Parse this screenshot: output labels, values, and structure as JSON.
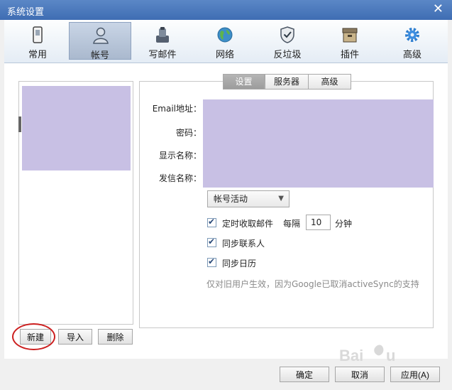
{
  "window": {
    "title": "系统设置"
  },
  "toolbar": {
    "items": [
      {
        "label": "常用",
        "icon": "phone-icon"
      },
      {
        "label": "帐号",
        "icon": "user-icon"
      },
      {
        "label": "写邮件",
        "icon": "compose-icon"
      },
      {
        "label": "网络",
        "icon": "globe-icon"
      },
      {
        "label": "反垃圾",
        "icon": "shield-icon"
      },
      {
        "label": "插件",
        "icon": "box-icon"
      },
      {
        "label": "高级",
        "icon": "gear-icon"
      }
    ],
    "active_index": 1
  },
  "account_panel": {
    "buttons": {
      "new": "新建",
      "import": "导入",
      "delete": "删除"
    }
  },
  "tabs": [
    "设置",
    "服务器",
    "高级"
  ],
  "form": {
    "email_label": "Email地址：",
    "password_label": "密码：",
    "display_name_label": "显示名称：",
    "sender_name_label": "发信名称：",
    "account_activity": "帐号活动",
    "auto_receive": {
      "label": "定时收取邮件",
      "checked": true,
      "every_label": "每隔",
      "interval": "10",
      "unit": "分钟"
    },
    "sync_contacts": {
      "label": "同步联系人",
      "checked": true
    },
    "sync_calendar": {
      "label": "同步日历",
      "checked": true
    },
    "note": "仅对旧用户生效，因为Google已取消activeSync的支持"
  },
  "footer": {
    "ok": "确定",
    "cancel": "取消",
    "apply": "应用(A)"
  },
  "colors": {
    "title_bar": "#3f6db3",
    "redacted": "#c8c0e4",
    "highlight_circle": "#cc1f1f"
  }
}
